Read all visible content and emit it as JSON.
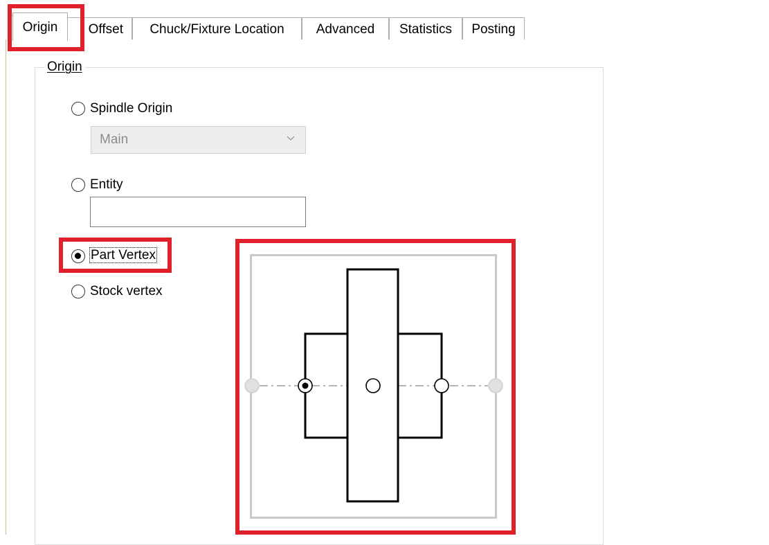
{
  "tabs": [
    {
      "label": "Origin",
      "active": true
    },
    {
      "label": "Offset",
      "active": false
    },
    {
      "label": "Chuck/Fixture Location",
      "active": false
    },
    {
      "label": "Advanced",
      "active": false
    },
    {
      "label": "Statistics",
      "active": false
    },
    {
      "label": "Posting",
      "active": false
    }
  ],
  "origin_group": {
    "title": "Origin",
    "options": [
      {
        "label": "Spindle Origin",
        "selected": false
      },
      {
        "label": "Entity",
        "selected": false
      },
      {
        "label": "Part Vertex",
        "selected": true
      },
      {
        "label": "Stock vertex",
        "selected": false
      }
    ],
    "spindle_dropdown": {
      "value": "Main"
    },
    "entity_field": {
      "value": ""
    }
  },
  "vertex_diagram": {
    "selected_point": "left-inner"
  },
  "colors": {
    "highlight": "#e0202a",
    "tab_border": "#adadad",
    "disabled_text": "#8a8a8a"
  }
}
